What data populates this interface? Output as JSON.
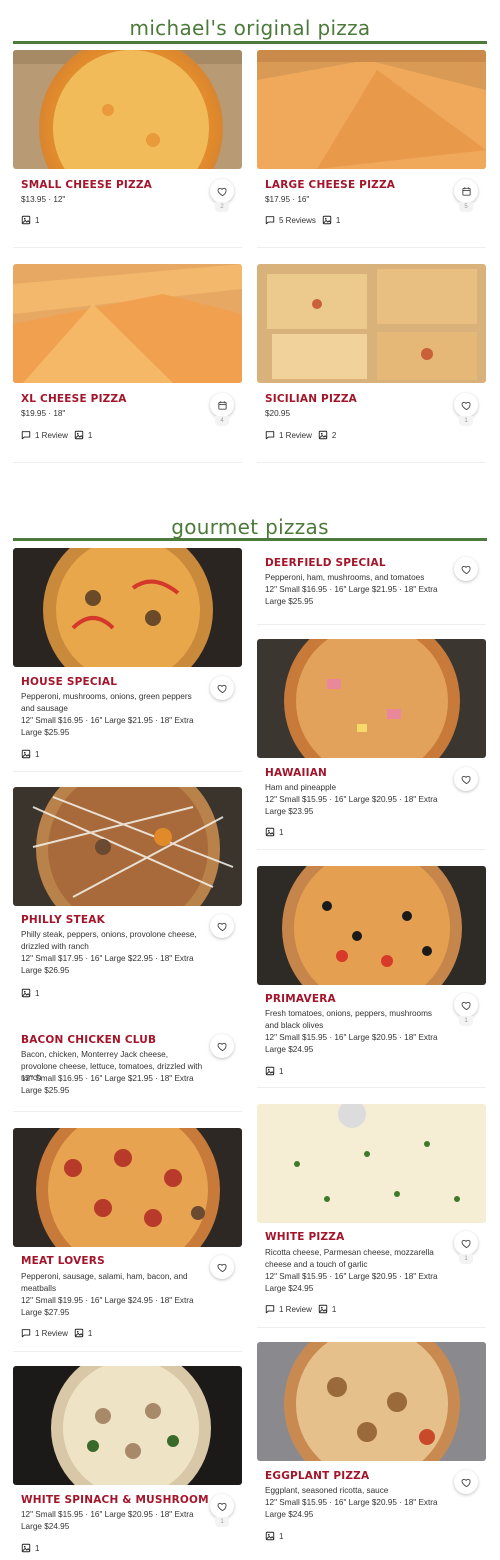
{
  "sections": {
    "original": {
      "title": "michael's original pizza"
    },
    "gourmet": {
      "title": "gourmet pizzas"
    }
  },
  "items": {
    "small_cheese": {
      "name": "SMALL CHEESE PIZZA",
      "price": "$13.95 · 12\"",
      "fav_count": "2",
      "photos": "1"
    },
    "large_cheese": {
      "name": "LARGE CHEESE PIZZA",
      "price": "$17.95 · 16\"",
      "fav_count": "5",
      "reviews": "5 Reviews",
      "photos": "1"
    },
    "xl_cheese": {
      "name": "XL CHEESE PIZZA",
      "price": "$19.95 · 18\"",
      "fav_count": "4",
      "reviews": "1 Review",
      "photos": "1"
    },
    "sicilian": {
      "name": "SICILIAN PIZZA",
      "price": "$20.95",
      "fav_count": "1",
      "reviews": "1 Review",
      "photos": "2"
    },
    "deerfield": {
      "name": "DEERFIELD SPECIAL",
      "desc": "Pepperoni, ham, mushrooms, and tomatoes",
      "price": "12\" Small $16.95 · 16\" Large $21.95 · 18\" Extra Large $25.95"
    },
    "house": {
      "name": "HOUSE SPECIAL",
      "desc": "Pepperoni, mushrooms, onions, green peppers and sausage",
      "price": "12\" Small $16.95 · 16\" Large $21.95 · 18\" Extra Large $25.95",
      "photos": "1"
    },
    "hawaiian": {
      "name": "HAWAIIAN",
      "desc": "Ham and pineapple",
      "price": "12\" Small $15.95 · 16\" Large $20.95 · 18\" Extra Large $23.95",
      "photos": "1"
    },
    "philly": {
      "name": "PHILLY STEAK",
      "desc": "Philly steak, peppers, onions, provolone cheese, drizzled with ranch",
      "price": "12\" Small $17.95 · 16\" Large $22.95 · 18\" Extra Large $26.95",
      "photos": "1"
    },
    "primavera": {
      "name": "PRIMAVERA",
      "desc": "Fresh tomatoes, onions, peppers, mushrooms and black olives",
      "price": "12\" Small $15.95 · 16\" Large $20.95 · 18\" Extra Large $24.95",
      "fav_count": "1",
      "photos": "1"
    },
    "bacon_chicken": {
      "name": "BACON CHICKEN CLUB",
      "desc": "Bacon, chicken, Monterrey Jack cheese, provolone cheese, lettuce, tomatoes, drizzled with ranch",
      "price": "12\" Small $16.95 · 16\" Large $21.95 · 18\" Extra Large $25.95"
    },
    "meat_lovers": {
      "name": "MEAT LOVERS",
      "desc": "Pepperoni, sausage, salami, ham, bacon, and meatballs",
      "price": "12\" Small $19.95 · 16\" Large $24.95 · 18\" Extra Large $27.95",
      "reviews": "1 Review",
      "photos": "1"
    },
    "white": {
      "name": "WHITE PIZZA",
      "desc": "Ricotta cheese, Parmesan cheese, mozzarella cheese and a touch of garlic",
      "price": "12\" Small $15.95 · 16\" Large $20.95 · 18\" Extra Large $24.95",
      "fav_count": "1",
      "reviews": "1 Review",
      "photos": "1"
    },
    "white_spinach": {
      "name": "WHITE SPINACH & MUSHROOM",
      "price": "12\" Small $15.95 · 16\" Large $20.95 · 18\" Extra Large $24.95",
      "fav_count": "1",
      "photos": "1"
    },
    "eggplant": {
      "name": "EGGPLANT PIZZA",
      "desc": "Eggplant, seasoned ricotta, sauce",
      "price": "12\" Small $15.95 · 16\" Large $20.95 · 18\" Extra Large $24.95",
      "photos": "1"
    }
  },
  "colors": {
    "accent_green": "#4c7a3a",
    "item_red": "#a3152a"
  }
}
